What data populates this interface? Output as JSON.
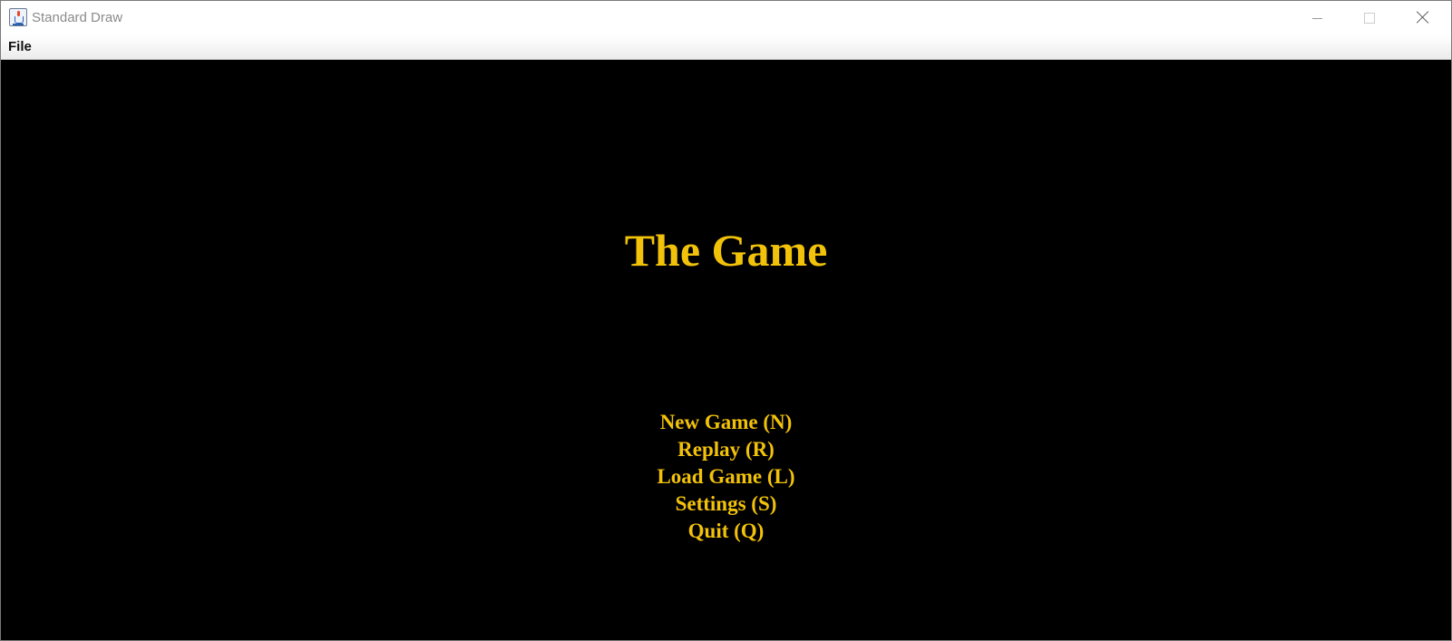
{
  "window": {
    "title": "Standard Draw",
    "icon": "java-cup-icon"
  },
  "menubar": {
    "items": [
      {
        "label": "File"
      }
    ]
  },
  "game": {
    "title": "The Game",
    "text_color": "#f2c20a",
    "background_color": "#000000",
    "menu": [
      {
        "label": "New Game (N)"
      },
      {
        "label": "Replay (R)"
      },
      {
        "label": "Load Game (L)"
      },
      {
        "label": "Settings (S)"
      },
      {
        "label": "Quit (Q)"
      }
    ]
  }
}
